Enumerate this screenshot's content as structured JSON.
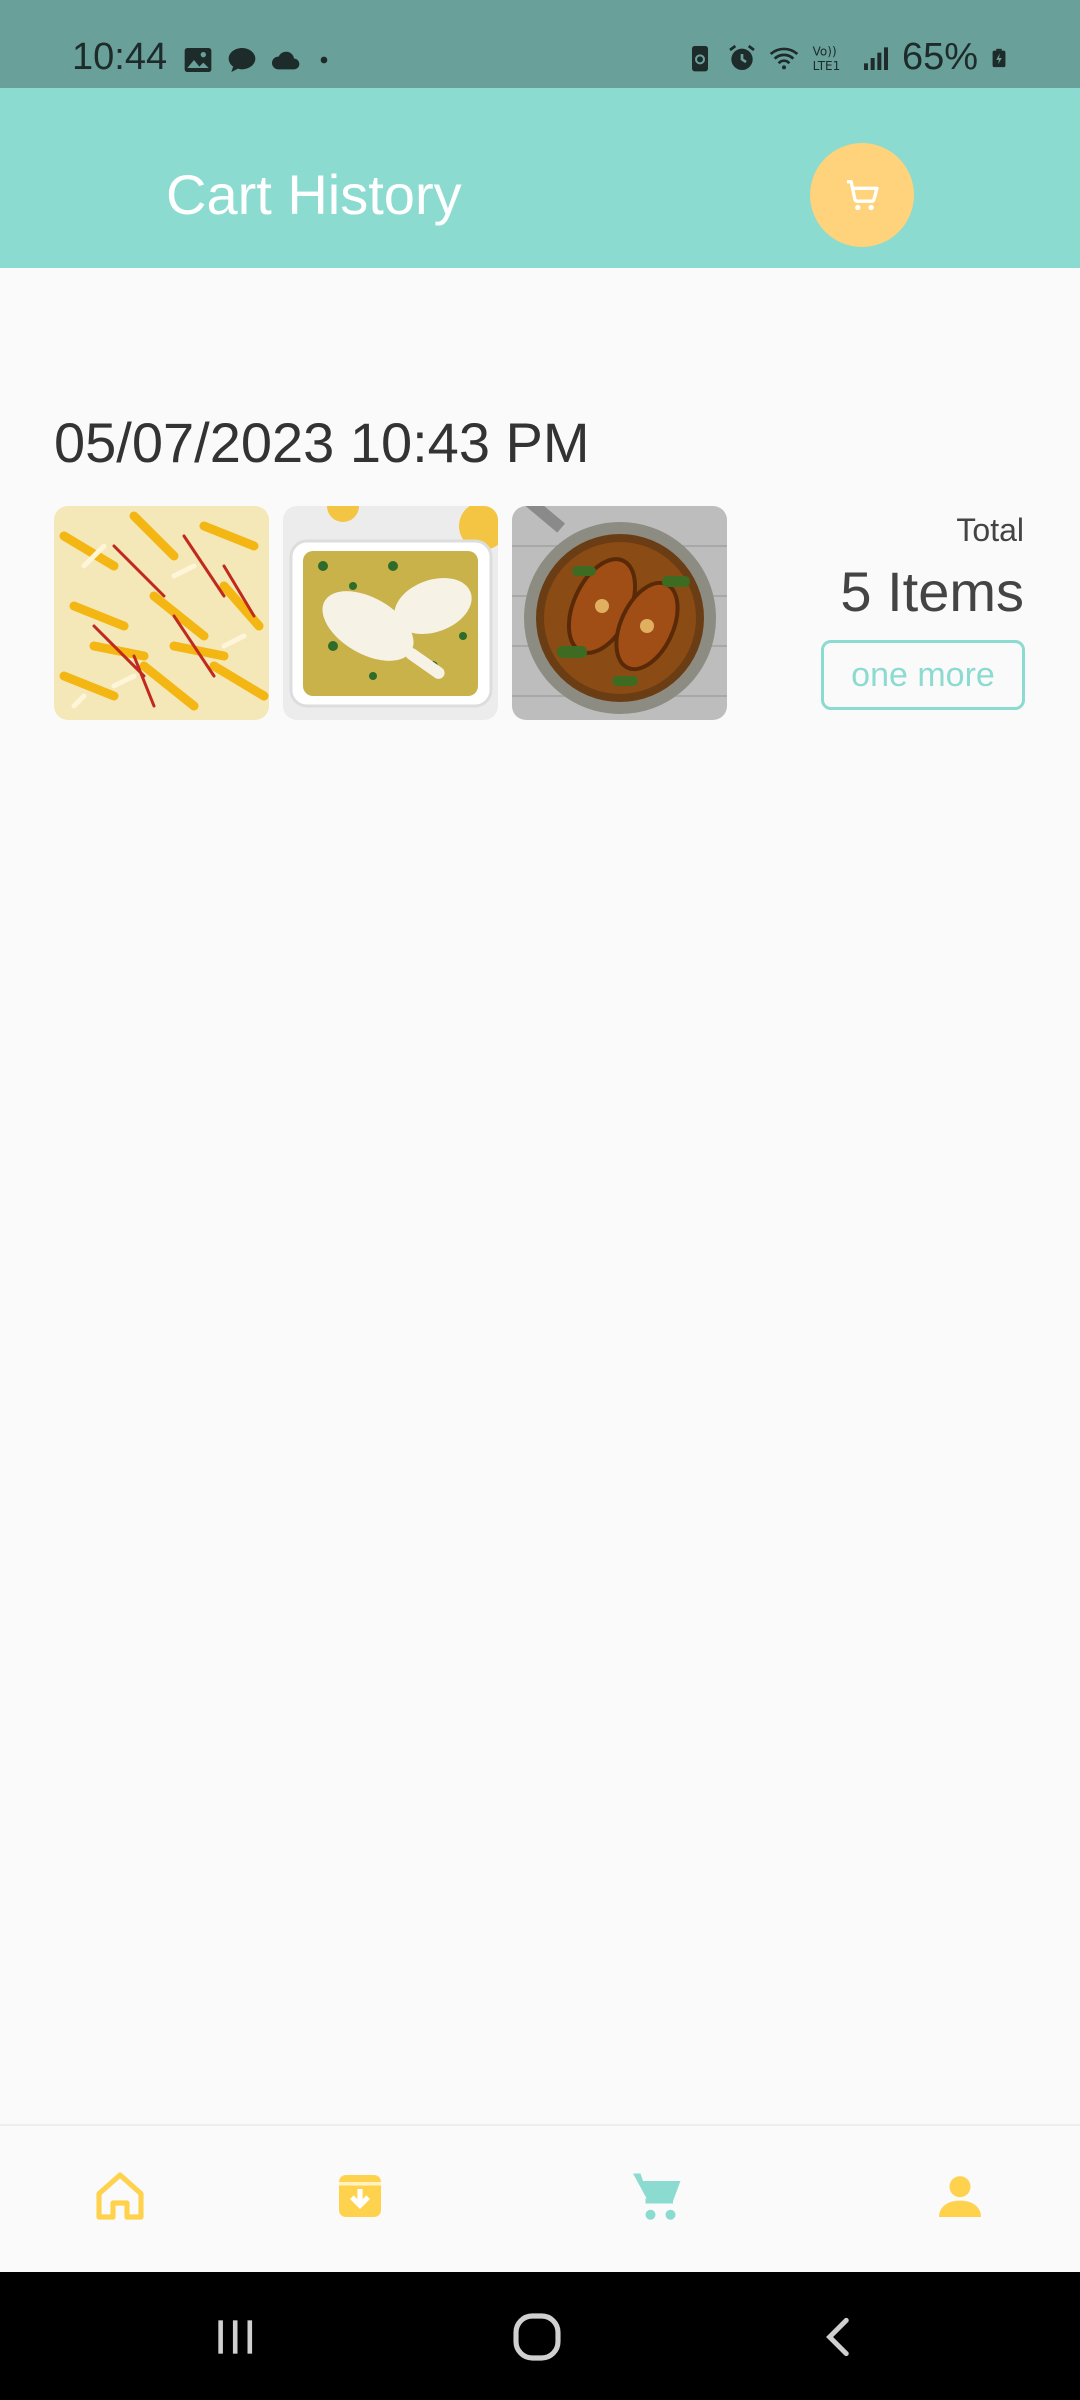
{
  "status_bar": {
    "time": "10:44",
    "battery": "65%",
    "left_icons": [
      "gallery-icon",
      "chat-icon",
      "cloud-icon",
      "dot-icon"
    ],
    "right_icons": [
      "battery-saver-icon",
      "alarm-icon",
      "wifi-icon",
      "volte-icon",
      "signal-icon",
      "battery-icon"
    ]
  },
  "header": {
    "title": "Cart History",
    "cart_icon": "cart-icon"
  },
  "history": [
    {
      "date": "05/07/2023 10:43 PM",
      "thumbnails": [
        "saffron-rice",
        "chicken-dish",
        "fish-curry"
      ],
      "total_label": "Total",
      "total_items": "5 Items",
      "action_label": "one more"
    }
  ],
  "bottom_nav": {
    "items": [
      "home-icon",
      "archive-icon",
      "cart-icon",
      "profile-icon"
    ],
    "active": "cart-icon"
  },
  "colors": {
    "primary": "#8cdbd0",
    "accent_yellow": "#fed37b",
    "nav_yellow": "#ffd24d",
    "status_bar": "#6aa09a"
  }
}
